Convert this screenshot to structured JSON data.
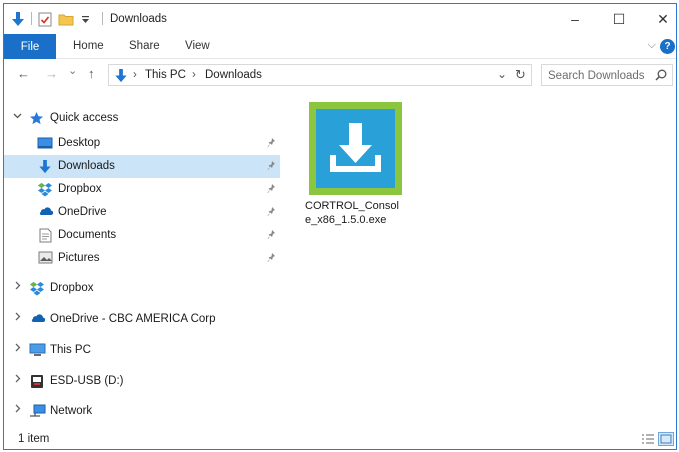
{
  "window": {
    "title": "Downloads",
    "controls": {
      "minimize": "–",
      "maximize": "☐",
      "close": "✕"
    }
  },
  "ribbon": {
    "tabs": [
      {
        "label": "File",
        "active": true
      },
      {
        "label": "Home"
      },
      {
        "label": "Share"
      },
      {
        "label": "View"
      }
    ],
    "expand_glyph": "⌵",
    "help_glyph": "?"
  },
  "navigation": {
    "back_glyph": "←",
    "forward_glyph": "→",
    "recent_glyph": "⌄",
    "up_glyph": "↑",
    "breadcrumb": [
      "This PC",
      "Downloads"
    ],
    "breadcrumb_separator": "›",
    "history_glyph": "⌄",
    "refresh_glyph": "↻"
  },
  "search": {
    "placeholder": "Search Downloads",
    "value": ""
  },
  "nav_pane": {
    "quick_access": {
      "label": "Quick access",
      "expanded": true,
      "items": [
        {
          "label": "Desktop",
          "icon": "desktop-icon",
          "pinned": true
        },
        {
          "label": "Downloads",
          "icon": "downloads-icon",
          "pinned": true,
          "selected": true
        },
        {
          "label": "Dropbox",
          "icon": "dropbox-icon",
          "pinned": true
        },
        {
          "label": "OneDrive",
          "icon": "onedrive-icon",
          "pinned": true
        },
        {
          "label": "Documents",
          "icon": "documents-icon",
          "pinned": true
        },
        {
          "label": "Pictures",
          "icon": "pictures-icon",
          "pinned": true
        }
      ]
    },
    "roots": [
      {
        "label": "Dropbox",
        "icon": "dropbox-icon"
      },
      {
        "label": "OneDrive - CBC AMERICA Corp",
        "icon": "onedrive-icon"
      },
      {
        "label": "This PC",
        "icon": "this-pc-icon"
      },
      {
        "label": "ESD-USB (D:)",
        "icon": "usb-drive-icon"
      },
      {
        "label": "Network",
        "icon": "network-icon"
      }
    ]
  },
  "files": [
    {
      "name": "CORTROL_Console_x86_1.5.0.exe",
      "icon": "installer-download-icon"
    }
  ],
  "status": {
    "item_count": "1 item",
    "view_mode": "large-icons"
  },
  "colors": {
    "accent": "#1a6fc9",
    "selection": "#cce4f7",
    "window_border": "#2b79d6",
    "file_thumb_frame": "#8cc63f",
    "file_thumb_fill": "#29a0d8"
  }
}
